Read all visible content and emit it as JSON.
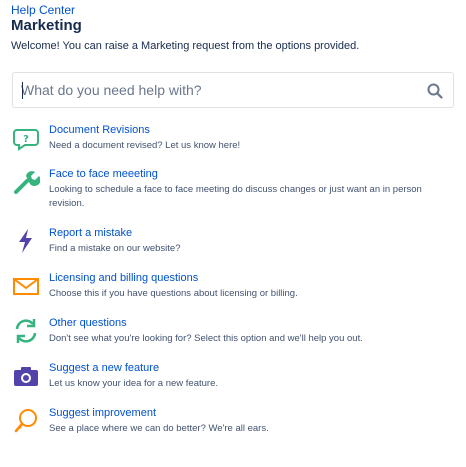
{
  "header": {
    "breadcrumb": "Help Center",
    "title": "Marketing",
    "welcome": "Welcome! You can raise a Marketing request from the options provided."
  },
  "search": {
    "placeholder": "What do you need help with?",
    "icon": "search-icon"
  },
  "colors": {
    "link": "#0052cc",
    "text": "#172b4d",
    "muted": "#42526e",
    "teal": "#36b37e",
    "purple": "#5243aa",
    "orange": "#ff8b00"
  },
  "request_types": [
    {
      "title": "Document Revisions",
      "description": "Need a document revised? Let us know here!",
      "icon": "speech-bubble-question-icon"
    },
    {
      "title": "Face to face meeeting",
      "description": "Looking to schedule a face to face meeting do discuss changes or just want an in person revision.",
      "icon": "wrench-icon"
    },
    {
      "title": "Report a mistake",
      "description": "Find a mistake on our website?",
      "icon": "lightning-bolt-icon"
    },
    {
      "title": "Licensing and billing questions",
      "description": "Choose this if you have questions about licensing or billing.",
      "icon": "envelope-icon"
    },
    {
      "title": "Other questions",
      "description": "Don't see what you're looking for? Select this option and we'll help you out.",
      "icon": "refresh-arrows-icon"
    },
    {
      "title": "Suggest a new feature",
      "description": "Let us know your idea for a new feature.",
      "icon": "camera-icon"
    },
    {
      "title": "Suggest improvement",
      "description": "See a place where we can do better? We're all ears.",
      "icon": "lightbulb-icon"
    }
  ]
}
